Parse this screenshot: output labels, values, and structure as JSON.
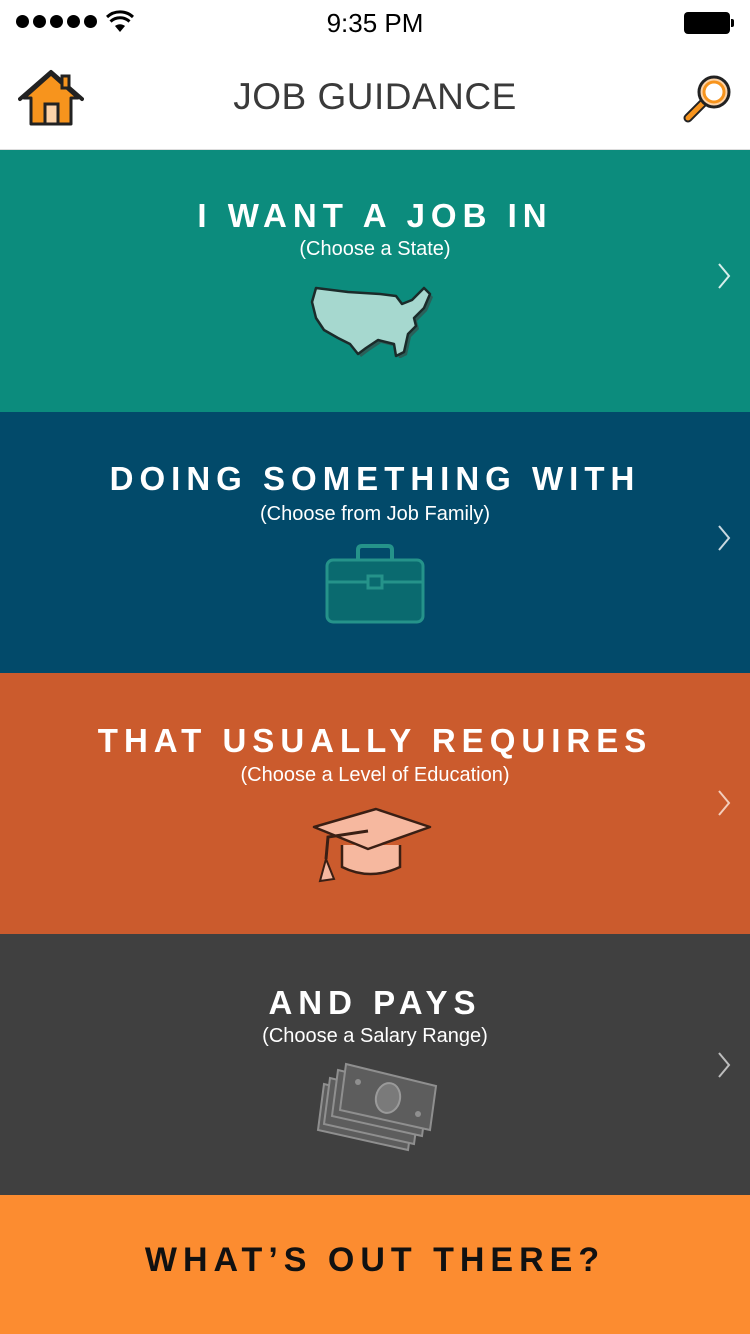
{
  "status_bar": {
    "time": "9:35 PM"
  },
  "header": {
    "title": "JOB GUIDANCE",
    "home_icon": "home-icon",
    "search_icon": "search-icon"
  },
  "panels": [
    {
      "title": "I WANT A JOB IN",
      "subtitle": "(Choose a State)",
      "icon": "usa-map-icon",
      "color": "#0c8c7d"
    },
    {
      "title": "DOING SOMETHING WITH",
      "subtitle": "(Choose from Job Family)",
      "icon": "briefcase-icon",
      "color": "#024a6a"
    },
    {
      "title": "THAT USUALLY REQUIRES",
      "subtitle": "(Choose a Level of Education)",
      "icon": "graduation-cap-icon",
      "color": "#cb5b2d"
    },
    {
      "title": "AND PAYS",
      "subtitle": "(Choose a Salary Range)",
      "icon": "money-icon",
      "color": "#404040"
    }
  ],
  "cta": {
    "label": "WHAT’S OUT THERE?",
    "color": "#fc8c30"
  },
  "colors": {
    "accent": "#fc8c30"
  }
}
